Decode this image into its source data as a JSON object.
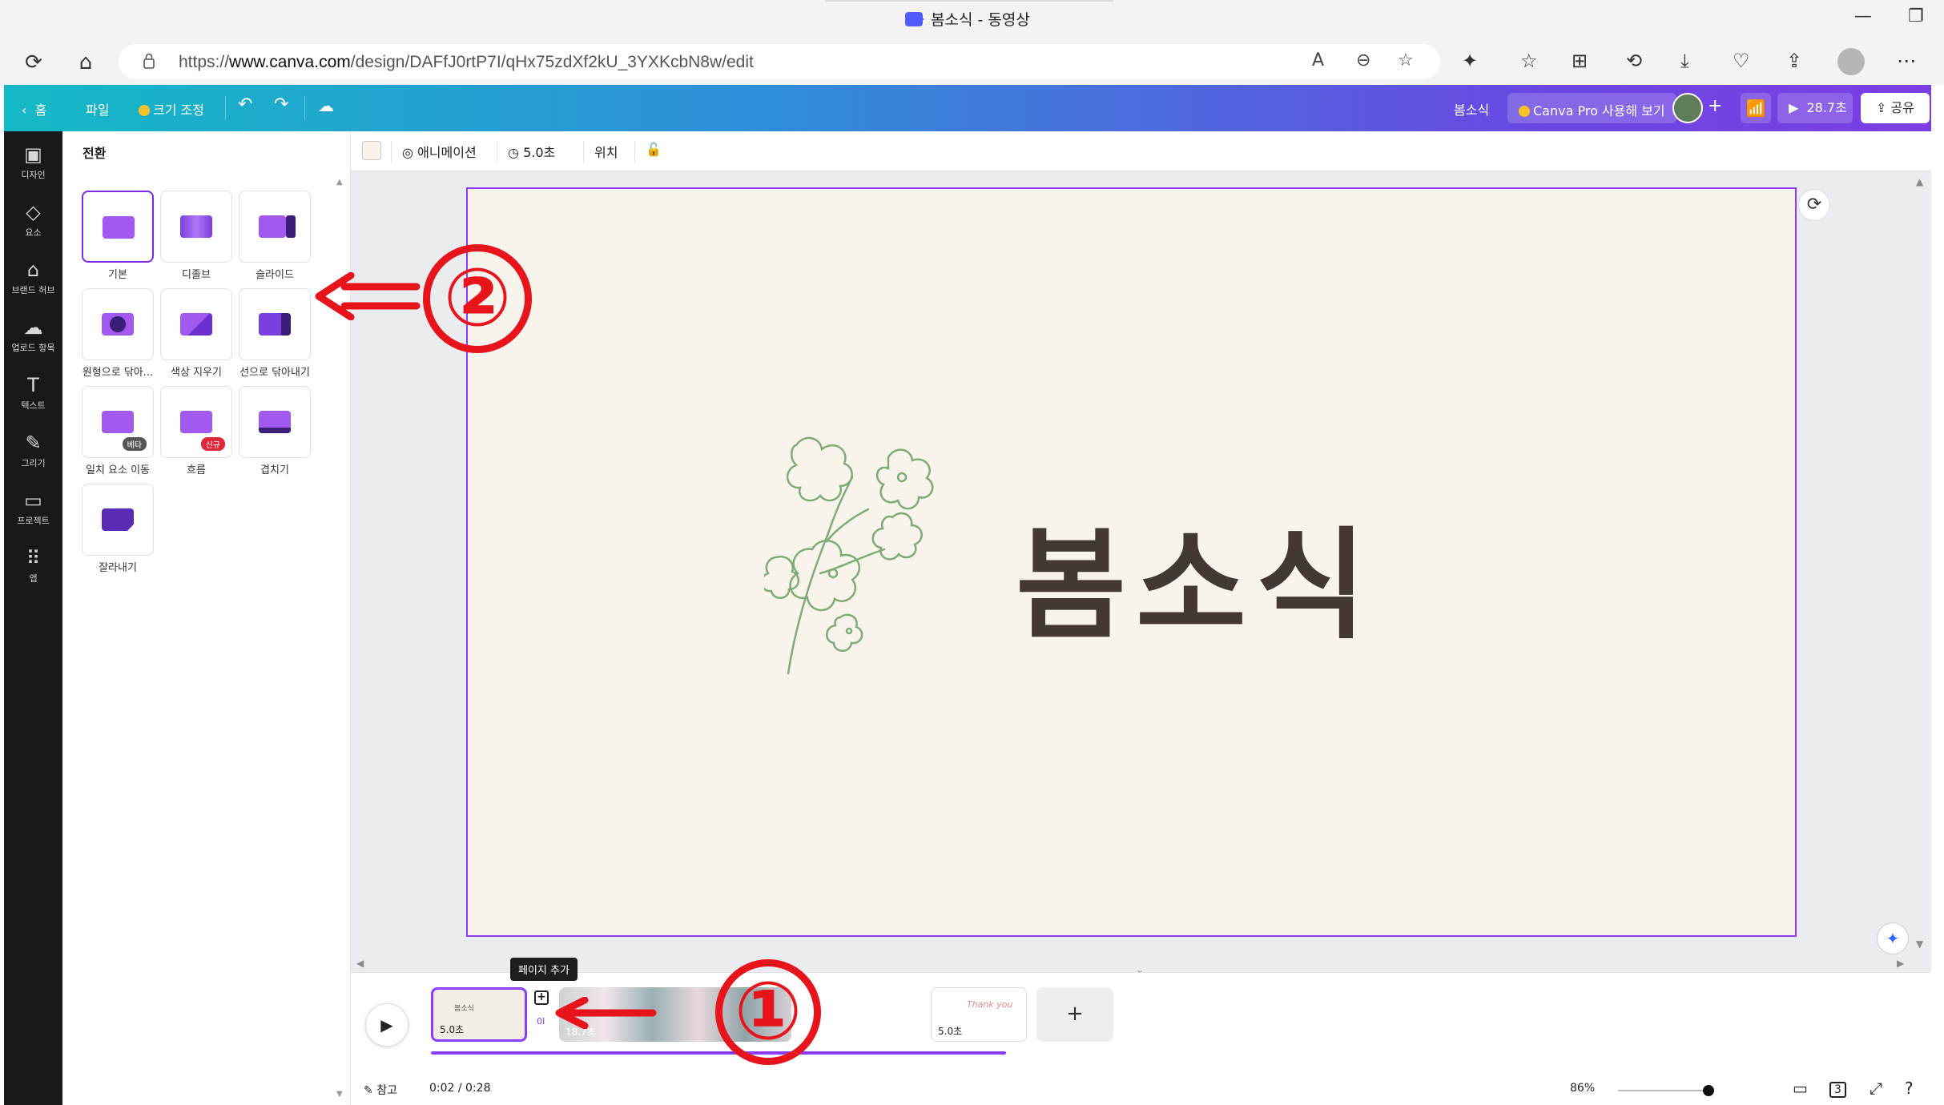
{
  "window": {
    "title": "봄소식 - 동영상"
  },
  "browser": {
    "url_prefix": "https://",
    "url_domain": "www.canva.com",
    "url_path": "/design/DAFfJ0rtP7I/qHx75zdXf2kU_3YXKcbN8w/edit"
  },
  "header": {
    "home_label": "홈",
    "file_label": "파일",
    "resize_label": "크기 조정",
    "design_name": "봄소식",
    "pro_label": "Canva Pro 사용해 보기",
    "play_label": "28.7초",
    "share_label": "공유"
  },
  "rail": {
    "items": [
      {
        "label": "디자인",
        "icon": "design-icon"
      },
      {
        "label": "요소",
        "icon": "elements-icon"
      },
      {
        "label": "브랜드 허브",
        "icon": "brand-icon"
      },
      {
        "label": "업로드 항목",
        "icon": "upload-icon"
      },
      {
        "label": "텍스트",
        "icon": "text-icon"
      },
      {
        "label": "그리기",
        "icon": "draw-icon"
      },
      {
        "label": "프로젝트",
        "icon": "folder-icon"
      },
      {
        "label": "앱",
        "icon": "apps-icon"
      }
    ]
  },
  "panel": {
    "title": "전환",
    "transitions": [
      {
        "label": "기본"
      },
      {
        "label": "디졸브"
      },
      {
        "label": "슬라이드"
      },
      {
        "label": "원형으로 닦아..."
      },
      {
        "label": "색상 지우기"
      },
      {
        "label": "선으로 닦아내기"
      },
      {
        "label": "일치 요소 이동",
        "badge": "베타"
      },
      {
        "label": "흐름",
        "badge": "신규"
      },
      {
        "label": "겹치기"
      },
      {
        "label": "잘라내기"
      }
    ]
  },
  "toolbar": {
    "animation_label": "애니메이션",
    "duration_label": "5.0초",
    "position_label": "위치"
  },
  "slide": {
    "title": "봄소식",
    "background": "#f8f4ec",
    "text_color": "#423834"
  },
  "timeline": {
    "tooltip": "페이지 추가",
    "clips": [
      {
        "duration": "5.0초",
        "thumb_text": "봄소식"
      },
      {
        "duration": "18.7초"
      },
      {
        "duration": "5.0초",
        "thumb_text": "Thank you"
      }
    ],
    "transition_marker": "0I",
    "notes_label": "참고",
    "time_display": "0:02 / 0:28",
    "zoom_label": "86%",
    "page_count": "3"
  },
  "annotations": {
    "one": "①",
    "two": "②"
  },
  "colors": {
    "accent": "#8b3dff",
    "annotation_red": "#e8141b"
  }
}
